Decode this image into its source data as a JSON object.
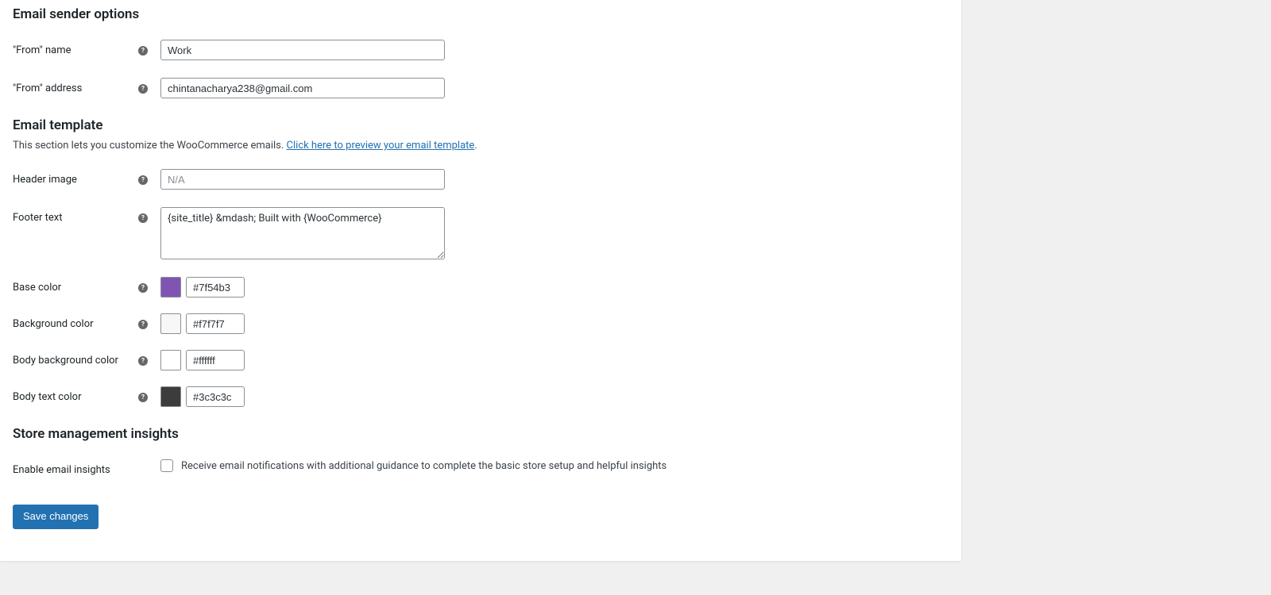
{
  "sections": {
    "sender": {
      "title": "Email sender options"
    },
    "template": {
      "title": "Email template",
      "desc_prefix": "This section lets you customize the WooCommerce emails. ",
      "desc_link": "Click here to preview your email template",
      "desc_suffix": "."
    },
    "insights": {
      "title": "Store management insights"
    }
  },
  "fields": {
    "from_name": {
      "label": "\"From\" name",
      "value": "Work"
    },
    "from_address": {
      "label": "\"From\" address",
      "value": "chintanacharya238@gmail.com"
    },
    "header_image": {
      "label": "Header image",
      "value": "",
      "placeholder": "N/A"
    },
    "footer_text": {
      "label": "Footer text",
      "value": "{site_title} &mdash; Built with {WooCommerce}"
    },
    "base_color": {
      "label": "Base color",
      "value": "#7f54b3",
      "swatch": "#7f54b3"
    },
    "background_color": {
      "label": "Background color",
      "value": "#f7f7f7",
      "swatch": "#f7f7f7"
    },
    "body_background_color": {
      "label": "Body background color",
      "value": "#ffffff",
      "swatch": "#ffffff"
    },
    "body_text_color": {
      "label": "Body text color",
      "value": "#3c3c3c",
      "swatch": "#3c3c3c"
    },
    "enable_insights": {
      "label": "Enable email insights",
      "checkbox_label": "Receive email notifications with additional guidance to complete the basic store setup and helpful insights",
      "checked": false
    }
  },
  "buttons": {
    "save": "Save changes"
  }
}
